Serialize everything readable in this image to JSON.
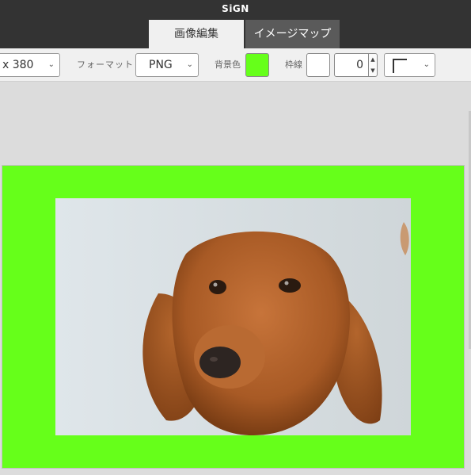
{
  "app": {
    "title": "SiGN"
  },
  "tabs": [
    {
      "label": "画像編集",
      "active": true
    },
    {
      "label": "イメージマップ",
      "active": false
    }
  ],
  "toolbar": {
    "size_value": "x 380",
    "format_label": "フォーマット",
    "format_value": "PNG",
    "background_label": "背景色",
    "background_color": "#66ff1a",
    "border_label": "枠線",
    "border_color": "#ffffff",
    "border_width": "0",
    "corner_style_icon": "corner-square-icon"
  },
  "canvas": {
    "background_color": "#66ff1a",
    "image_subject": "dog-photo"
  },
  "icons": {
    "chevron": "⌄",
    "spin_up": "▲",
    "spin_down": "▼"
  }
}
